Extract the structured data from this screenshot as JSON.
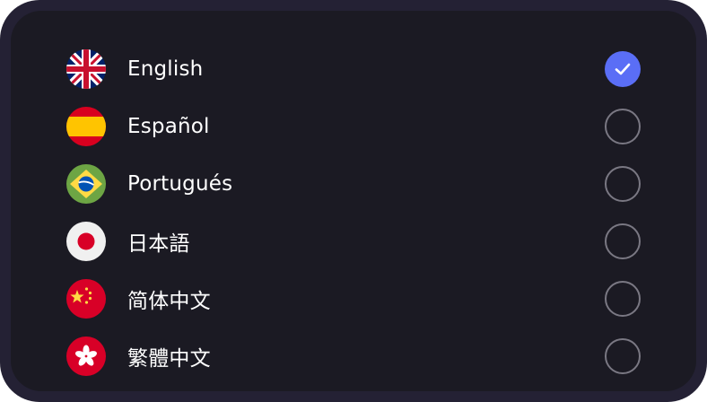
{
  "language_selector": {
    "selected_index": 0,
    "accent_color": "#5a6ef6",
    "options": [
      {
        "label": "English",
        "flag_icon": "uk-flag-icon",
        "selected": true
      },
      {
        "label": "Español",
        "flag_icon": "spain-flag-icon",
        "selected": false
      },
      {
        "label": "Portugués",
        "flag_icon": "brazil-flag-icon",
        "selected": false
      },
      {
        "label": "日本語",
        "flag_icon": "japan-flag-icon",
        "selected": false
      },
      {
        "label": "简体中文",
        "flag_icon": "china-flag-icon",
        "selected": false
      },
      {
        "label": "繁體中文",
        "flag_icon": "hong-kong-flag-icon",
        "selected": false
      }
    ]
  }
}
